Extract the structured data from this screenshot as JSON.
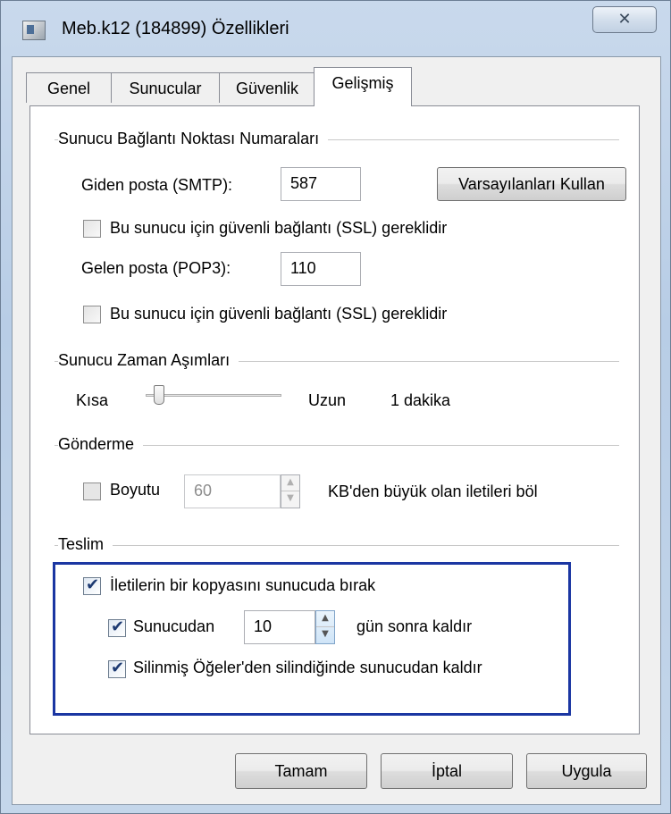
{
  "window": {
    "title": "Meb.k12 (184899) Özellikleri",
    "close_glyph": "✕"
  },
  "tabs": [
    {
      "label": "Genel",
      "active": false
    },
    {
      "label": "Sunucular",
      "active": false
    },
    {
      "label": "Güvenlik",
      "active": false
    },
    {
      "label": "Gelişmiş",
      "active": true
    }
  ],
  "ports": {
    "group_label": "Sunucu Bağlantı Noktası Numaraları",
    "smtp_label": "Giden posta (SMTP):",
    "smtp_value": "587",
    "defaults_button": "Varsayılanları Kullan",
    "smtp_ssl_label": "Bu sunucu için güvenli bağlantı (SSL) gereklidir",
    "smtp_ssl_checked": false,
    "pop3_label": "Gelen posta (POP3):",
    "pop3_value": "110",
    "pop3_ssl_label": "Bu sunucu için güvenli bağlantı (SSL) gereklidir",
    "pop3_ssl_checked": false
  },
  "timeouts": {
    "group_label": "Sunucu Zaman Aşımları",
    "short_label": "Kısa",
    "long_label": "Uzun",
    "value_text": "1 dakika",
    "slider_fraction": 0.1
  },
  "sending": {
    "group_label": "Gönderme",
    "size_checkbox_label": "Boyutu",
    "size_checked": false,
    "size_value": "60",
    "size_suffix": "KB'den büyük olan iletileri böl"
  },
  "delivery": {
    "group_label": "Teslim",
    "leave_copy_label": "İletilerin bir kopyasını sunucuda bırak",
    "leave_copy_checked": true,
    "remove_after_label": "Sunucudan",
    "remove_after_checked": true,
    "remove_after_days": "10",
    "remove_after_suffix": "gün sonra kaldır",
    "remove_deleted_label": "Silinmiş Öğeler'den silindiğinde sunucudan kaldır",
    "remove_deleted_checked": true,
    "highlight_color": "#1b36a2"
  },
  "buttons": {
    "ok": "Tamam",
    "cancel": "İptal",
    "apply": "Uygula"
  },
  "icons": {
    "window_icon": "mail-account-icon",
    "checkmark": "✔",
    "spin_up": "▲",
    "spin_down": "▼"
  }
}
